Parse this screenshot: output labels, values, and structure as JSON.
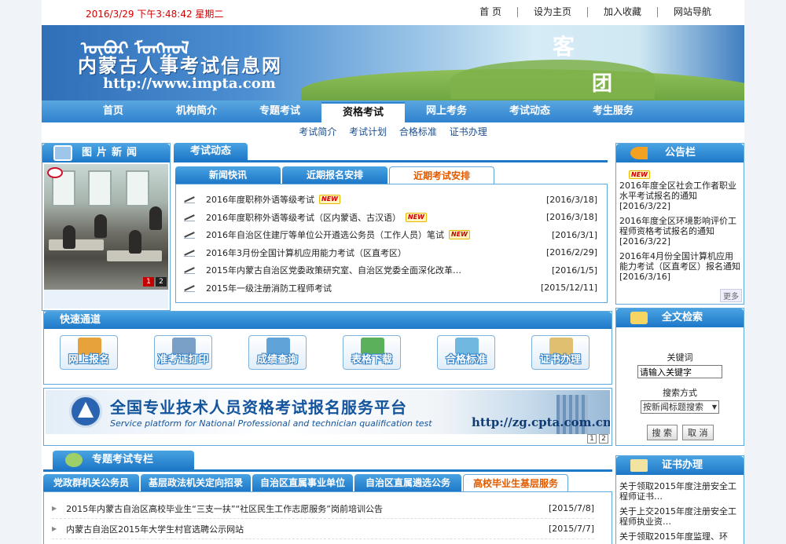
{
  "topbar": {
    "datetime": "2016/3/29 下午3:48:42 星期二",
    "links": [
      "首 页",
      "设为主页",
      "加入收藏",
      "网站导航"
    ]
  },
  "banner": {
    "mongolian": "ᠥᠪᠦᠷ ᠮᠣᠩᠭᠣᠯ",
    "sitename": "内蒙古人事考试信息网",
    "url": "http://www.impta.com",
    "char1": "客",
    "char2": "团"
  },
  "mainnav": {
    "items": [
      "首页",
      "机构简介",
      "专题考试",
      "资格考试",
      "网上考务",
      "考试动态",
      "考生服务"
    ],
    "active_index": 3
  },
  "subnav": {
    "items": [
      "考试简介",
      "考试计划",
      "合格标准",
      "证书办理"
    ]
  },
  "picnews": {
    "title": "图片新闻",
    "pages": [
      "1",
      "2"
    ]
  },
  "examnews": {
    "title": "考试动态",
    "tabs": [
      "新闻快讯",
      "近期报名安排",
      "近期考试安排"
    ],
    "active_tab": 2,
    "new_label": "NEW",
    "items": [
      {
        "title": "2016年度职称外语等级考试",
        "date": "[2016/3/18]",
        "new": true
      },
      {
        "title": "2016年度职称外语等级考试（区内蒙语、古汉语）",
        "date": "[2016/3/18]",
        "new": true
      },
      {
        "title": "2016年自治区住建厅等单位公开遴选公务员（工作人员）笔试",
        "date": "[2016/3/1]",
        "new": true
      },
      {
        "title": "2016年3月份全国计算机应用能力考试（区直考区）",
        "date": "[2016/2/29]",
        "new": false
      },
      {
        "title": "2015年内蒙古自治区党委政策研究室、自治区党委全面深化改革…",
        "date": "[2016/1/5]",
        "new": false
      },
      {
        "title": "2015年一级注册消防工程师考试",
        "date": "[2015/12/11]",
        "new": false
      }
    ]
  },
  "notice": {
    "title": "公告栏",
    "new_label": "NEW",
    "items": [
      "2016年度全区社会工作者职业水平考试报名的通知 [2016/3/22]",
      "2016年度全区环境影响评价工程师资格考试报名的通知 [2016/3/22]",
      "2016年4月份全国计算机应用能力考试（区直考区）报名通知 [2016/3/16]"
    ],
    "more": "更多"
  },
  "quick": {
    "title": "快速通道",
    "buttons": [
      {
        "label": "网上报名",
        "color": "#e8a23c"
      },
      {
        "label": "准考证打印",
        "color": "#7aa0c8"
      },
      {
        "label": "成绩查询",
        "color": "#5fa3d8"
      },
      {
        "label": "表格下载",
        "color": "#5bb05b"
      },
      {
        "label": "合格标准",
        "color": "#70b8e0"
      },
      {
        "label": "证书办理",
        "color": "#e0c070"
      }
    ]
  },
  "search": {
    "title": "全文检索",
    "keyword_label": "关键词",
    "keyword_placeholder": "请输入关键字",
    "mode_label": "搜索方式",
    "mode_value": "按新闻标题搜索",
    "search_btn": "搜 索",
    "cancel_btn": "取 消"
  },
  "platform": {
    "title": "全国专业技术人员资格考试报名服务平台",
    "subtitle": "Service platform for National Professional and technician  qualification test",
    "url": "http://zg.cpta.com.cn",
    "pages": [
      "1",
      "2"
    ]
  },
  "special": {
    "title": "专题考试专栏",
    "tabs": [
      "党政群机关公务员",
      "基层政法机关定向招录",
      "自治区直属事业单位",
      "自治区直属遴选公务员",
      "高校毕业生基层服务"
    ],
    "active_tab": 4,
    "items": [
      {
        "title": "2015年内蒙古自治区高校毕业生“三支一扶”“社区民生工作志愿服务”岗前培训公告",
        "date": "[2015/7/8]"
      },
      {
        "title": "内蒙古自治区2015年大学生村官选聘公示网站",
        "date": "[2015/7/7]"
      }
    ]
  },
  "cert": {
    "title": "证书办理",
    "items": [
      "关于领取2015年度注册安全工程师证书…",
      "关于上交2015年度注册安全工程师执业资…",
      "关于领取2015年度监理、环"
    ]
  }
}
